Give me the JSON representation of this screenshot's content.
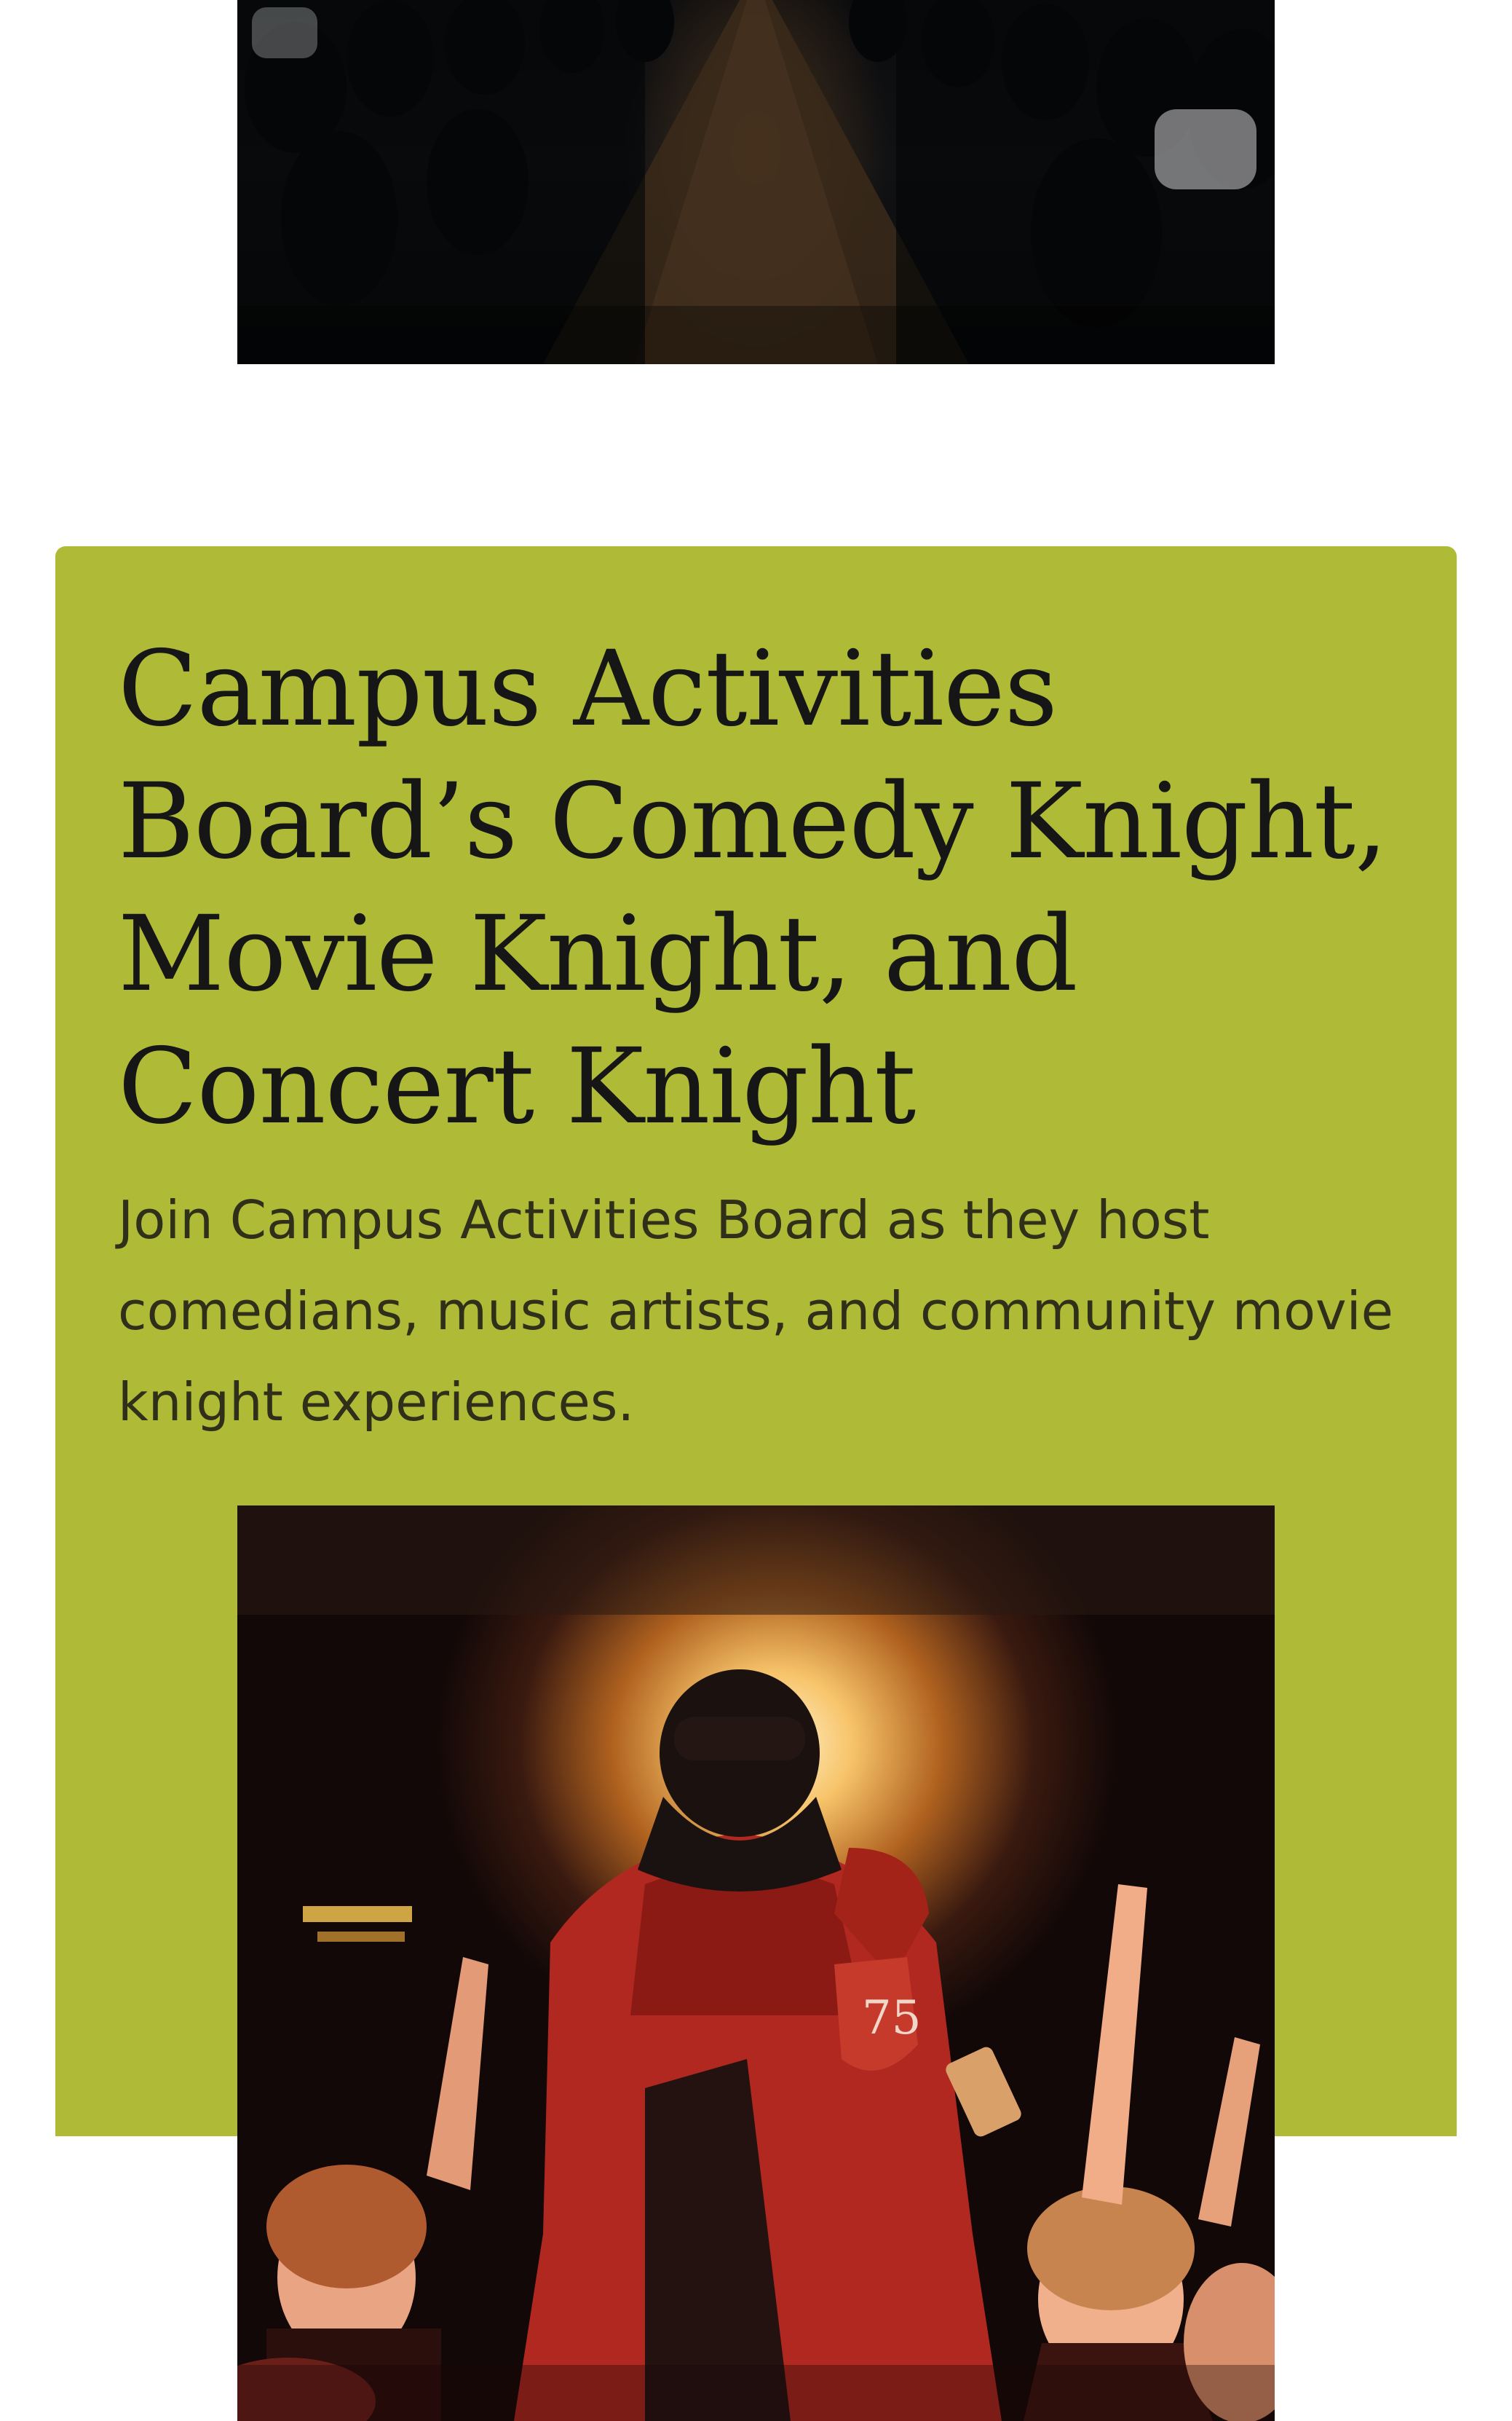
{
  "top_image": {
    "alt": "auditorium-aisle-photo"
  },
  "card": {
    "background": "#afbb37",
    "title": "Campus Activities Board’s Comedy Knight, Movie Knight, and Concert Knight",
    "description": "Join Campus Activities Board as they host comedians, music artists, and community movie knight experiences."
  },
  "bottom_image": {
    "alt": "concert-performer-photo",
    "jacket_number": "75"
  }
}
